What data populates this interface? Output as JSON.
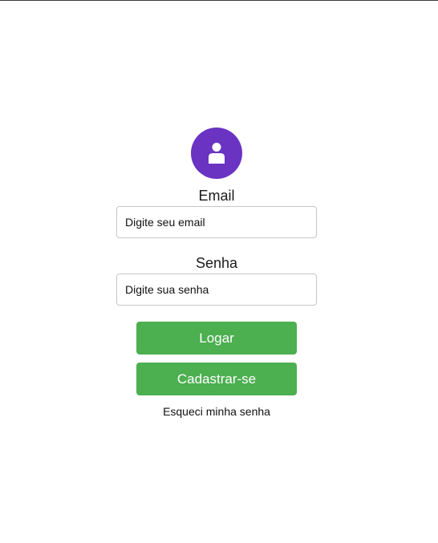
{
  "avatar": {
    "icon": "user-icon",
    "color": "#6a33c2"
  },
  "email": {
    "label": "Email",
    "placeholder": "Digite seu email"
  },
  "password": {
    "label": "Senha",
    "placeholder": "Digite sua senha"
  },
  "buttons": {
    "login_label": "Logar",
    "register_label": "Cadastrar-se",
    "color": "#4caf50"
  },
  "forgot_password": "Esqueci minha senha"
}
